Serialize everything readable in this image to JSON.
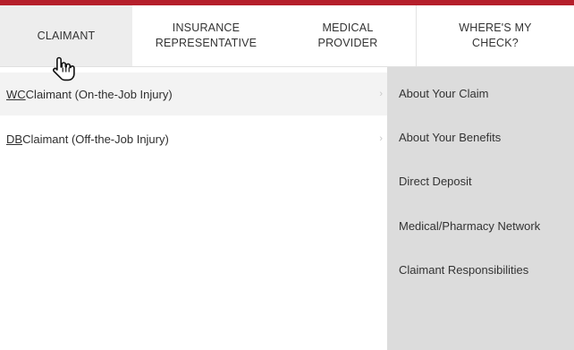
{
  "nav": {
    "tabs": [
      {
        "label": "CLAIMANT",
        "active": true
      },
      {
        "label": "INSURANCE\nREPRESENTATIVE",
        "active": false
      },
      {
        "label": "MEDICAL\nPROVIDER",
        "active": false
      },
      {
        "label": "WHERE'S MY\nCHECK?",
        "active": false
      }
    ]
  },
  "submenu": {
    "left": [
      {
        "abbr": "WC",
        "rest": " Claimant (On-the-Job Injury)"
      },
      {
        "abbr": "DB",
        "rest": " Claimant (Off-the-Job Injury)"
      }
    ],
    "right": [
      {
        "label": "About Your Claim"
      },
      {
        "label": "About Your Benefits"
      },
      {
        "label": "Direct Deposit"
      },
      {
        "label": "Medical/Pharmacy Network"
      },
      {
        "label": "Claimant Responsibilities"
      }
    ]
  },
  "colors": {
    "accent": "#b51f2b",
    "active_tab_bg": "#ededed",
    "flyout_bg": "#dcdcdc"
  },
  "icons": {
    "cursor": "hand-pointer-icon",
    "submenu_arrow": "chevron-right-icon"
  }
}
